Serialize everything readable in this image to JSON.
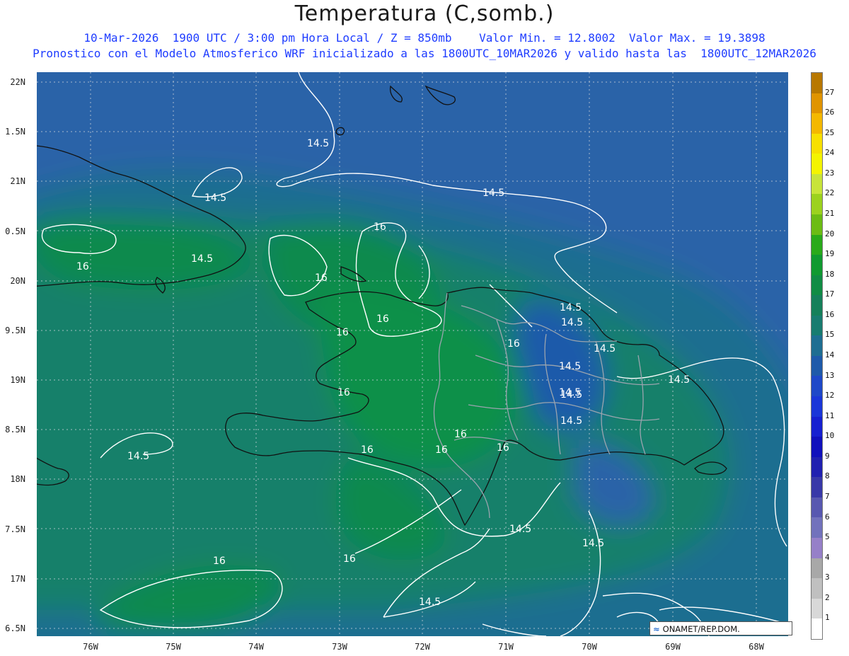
{
  "header": {
    "title": "Temperatura (C,somb.)",
    "line1": "10-Mar-2026  1900 UTC / 3:00 pm Hora Local / Z = 850mb    Valor Min. = 12.8002  Valor Max. = 19.3898",
    "line2": "Pronostico con el Modelo Atmosferico WRF inicializado a las 1800UTC_10MAR2026 y valido hasta las  1800UTC_12MAR2026"
  },
  "axes": {
    "lat_labels": [
      "22N",
      "1.5N",
      "21N",
      "0.5N",
      "20N",
      "9.5N",
      "19N",
      "8.5N",
      "18N",
      "7.5N",
      "17N",
      "6.5N"
    ],
    "lon_labels": [
      "76W",
      "75W",
      "74W",
      "73W",
      "72W",
      "71W",
      "70W",
      "69W",
      "68W"
    ]
  },
  "colorbar": {
    "labels": [
      "27",
      "26",
      "25",
      "24",
      "23",
      "22",
      "21",
      "20",
      "19",
      "18",
      "17",
      "16",
      "15",
      "14",
      "13",
      "12",
      "11",
      "10",
      "9",
      "8",
      "7",
      "6",
      "5",
      "4",
      "3",
      "2",
      "1"
    ],
    "colors": [
      "#b87800",
      "#e09400",
      "#f4b800",
      "#f8e000",
      "#f4f400",
      "#c8e43a",
      "#9cd21e",
      "#6cbc14",
      "#2aaa1a",
      "#109a30",
      "#108c44",
      "#15805a",
      "#187c70",
      "#1e6e92",
      "#1e5aaa",
      "#1e48c8",
      "#1a36d8",
      "#1620d0",
      "#1010bc",
      "#2020b0",
      "#3838a8",
      "#5858b0",
      "#7272bc",
      "#9680c8",
      "#a8a8a8",
      "#c0c0c0",
      "#d8d8d8",
      "#ffffff"
    ]
  },
  "contours": {
    "labels": [
      "14.5",
      "14.5",
      "14.5",
      "14.5",
      "16",
      "16",
      "16",
      "16",
      "14.5",
      "14.5",
      "14.5",
      "14.5",
      "16",
      "16",
      "16",
      "14.5",
      "14.5",
      "16",
      "16",
      "16",
      "16",
      "14.5",
      "14.5",
      "16"
    ]
  },
  "credit": {
    "text": "ONAMET/REP.DOM."
  }
}
